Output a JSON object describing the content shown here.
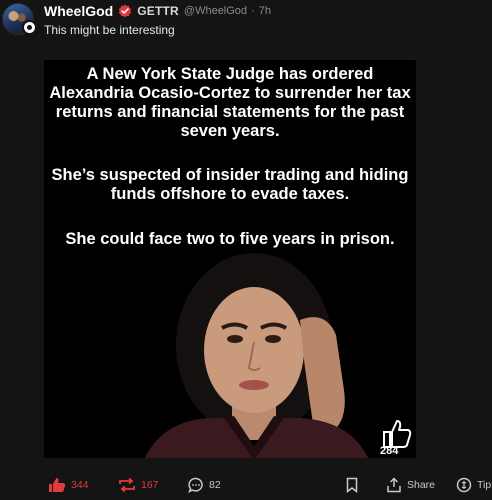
{
  "post": {
    "username": "WheelGod",
    "platform_brand": "GETTR",
    "handle": "@WheelGod",
    "separator": "·",
    "timestamp": "7h",
    "text": "This might be interesting"
  },
  "media": {
    "paragraph_1": "A New York State Judge has ordered Alexandria Ocasio-Cortez to surrender her tax returns and financial statements for the past seven years.",
    "paragraph_2": "She’s suspected of insider trading and hiding funds offshore to evade taxes.",
    "paragraph_3": "She could face two to five years in prison.",
    "like_count_overlay": "284"
  },
  "actions": {
    "like_count": "344",
    "repost_count": "167",
    "comment_count": "82",
    "share_label": "Share",
    "tip_label": "Tip"
  },
  "colors": {
    "background": "#141414",
    "accent_red": "#e23b3b",
    "text_primary": "#ffffff",
    "text_secondary": "#8a8a8a"
  },
  "icons": [
    "avatar",
    "verified-badge-icon",
    "thumbs-up-icon",
    "like-icon",
    "repost-icon",
    "comment-icon",
    "bookmark-icon",
    "share-icon",
    "tip-icon"
  ]
}
